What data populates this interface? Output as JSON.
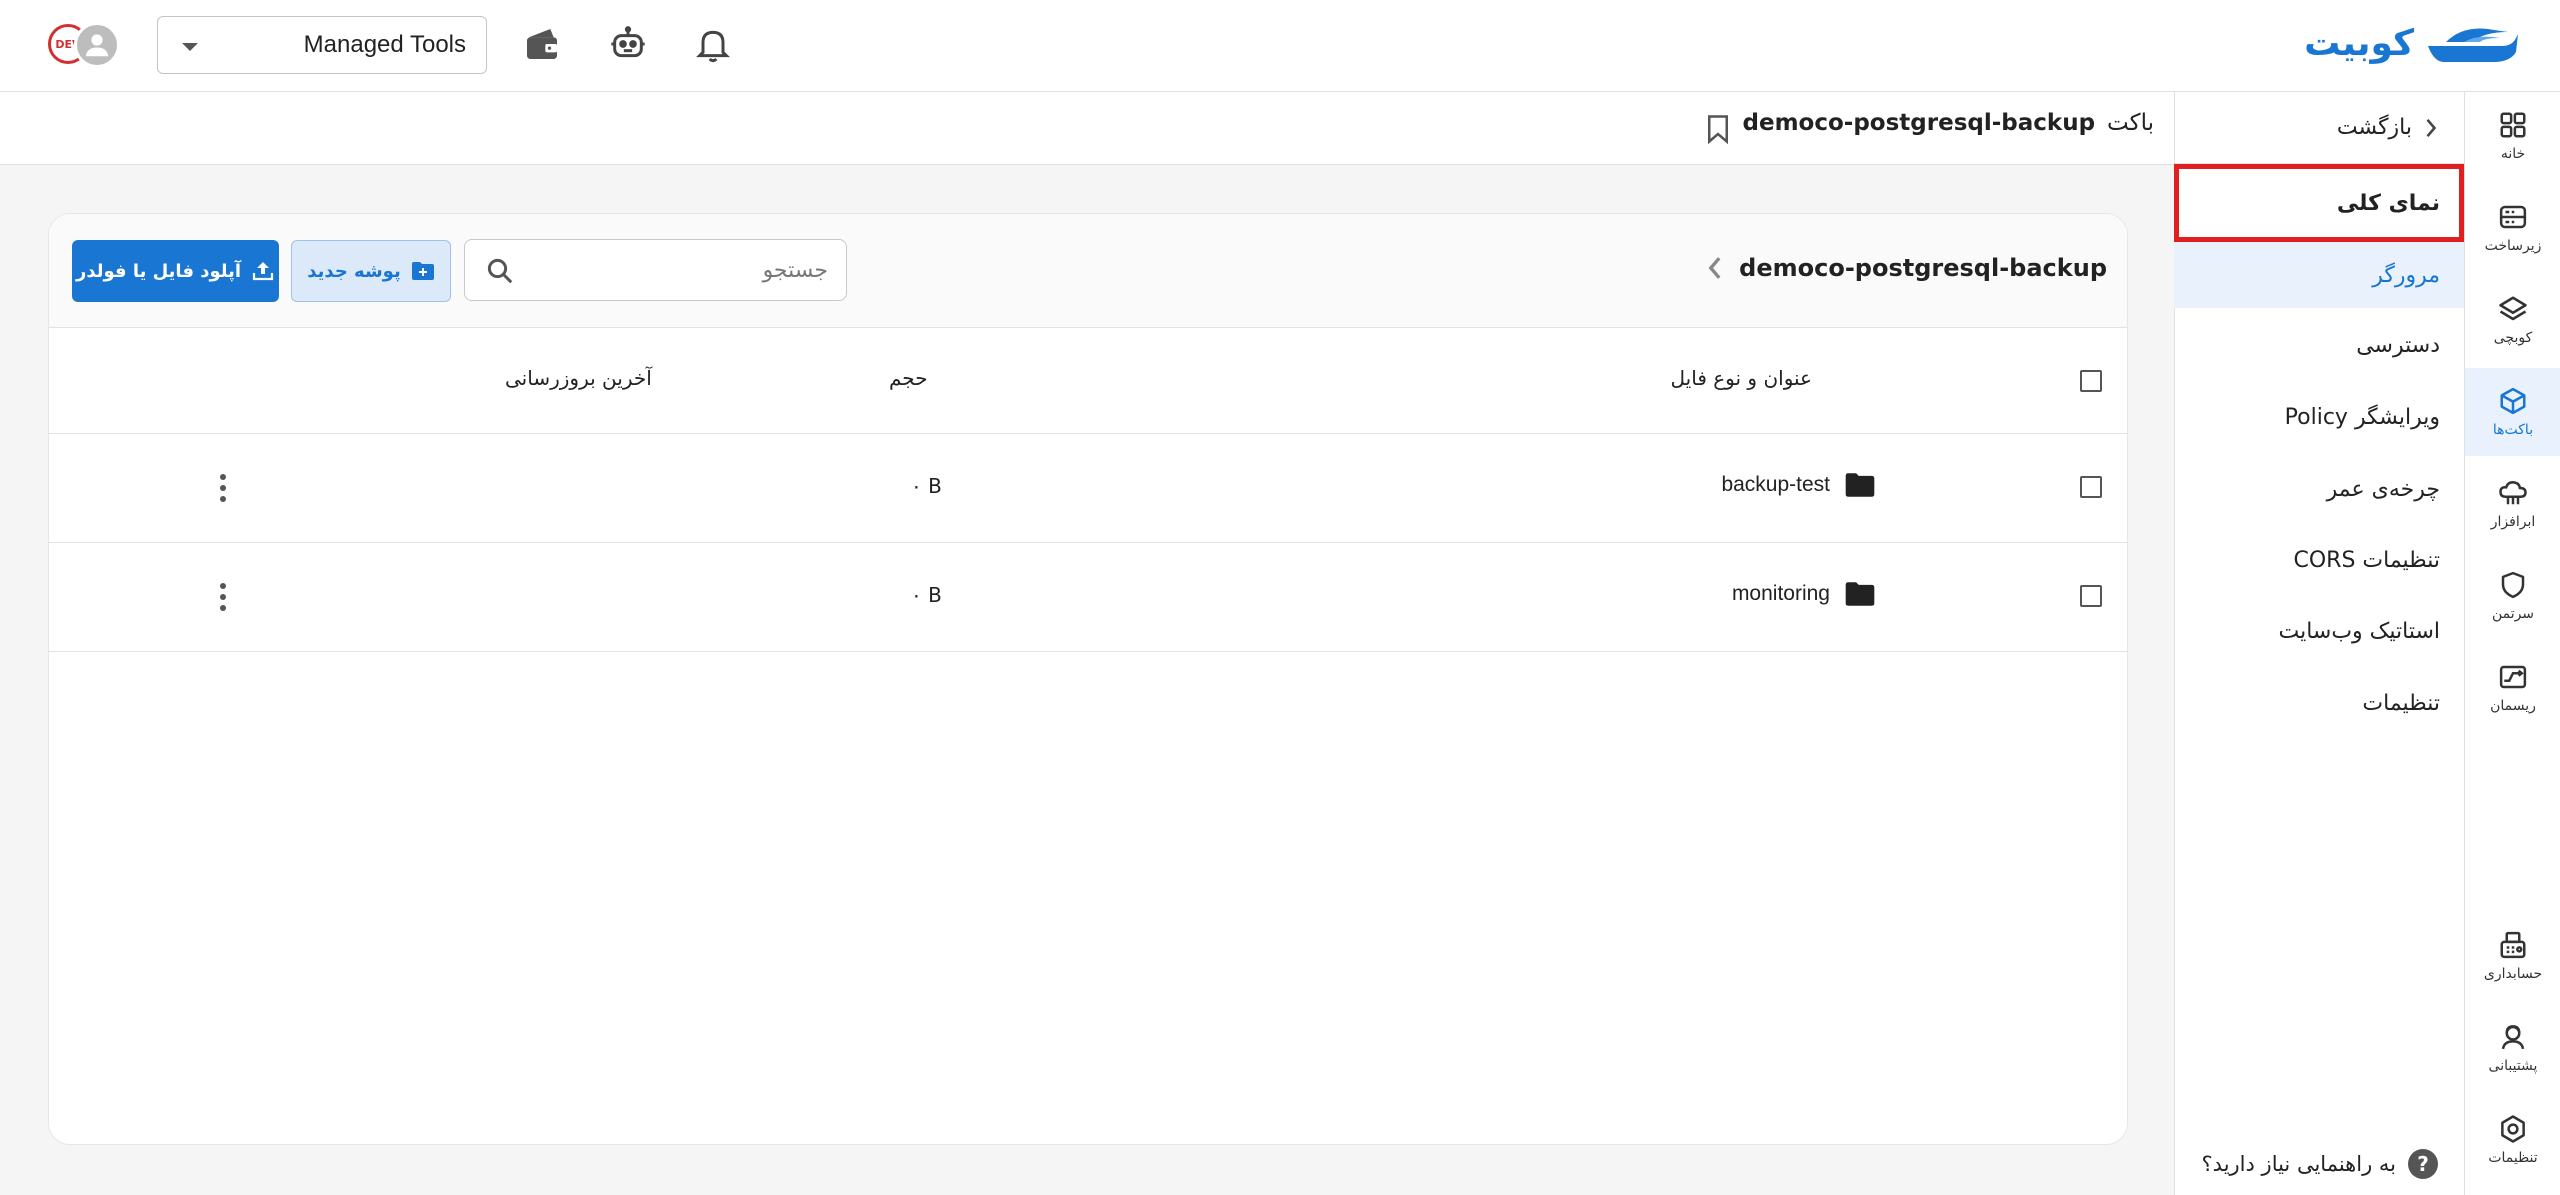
{
  "header": {
    "logo_text": "کوبیت",
    "org_select_value": "Managed Tools",
    "avatar_badge": "DEV",
    "icons": [
      "bell-icon",
      "robot-icon",
      "wallet-icon"
    ]
  },
  "rail": {
    "items": [
      {
        "label": "خانه",
        "icon": "home-grid-icon"
      },
      {
        "label": "زیرساخت",
        "icon": "server-icon"
      },
      {
        "label": "کوبچی",
        "icon": "layers-icon"
      },
      {
        "label": "باکت‌ها",
        "icon": "cube-icon"
      },
      {
        "label": "ابرافزار",
        "icon": "cloud-app-icon"
      },
      {
        "label": "سرتمن",
        "icon": "shield-icon"
      },
      {
        "label": "ریسمان",
        "icon": "rope-icon"
      },
      {
        "label": "حسابداری",
        "icon": "accounting-icon"
      },
      {
        "label": "پشتیبانی",
        "icon": "support-icon"
      },
      {
        "label": "تنظیمات",
        "icon": "settings-icon"
      }
    ],
    "active_index": 3
  },
  "submenu": {
    "back_label": "بازگشت",
    "items": [
      {
        "label": "نمای کلی"
      },
      {
        "label": "مرورگر"
      },
      {
        "label": "دسترسی"
      },
      {
        "label": "ویرایشگر Policy"
      },
      {
        "label": "چرخه‌ی عمر"
      },
      {
        "label": "تنظیمات CORS"
      },
      {
        "label": "استاتیک وب‌سایت"
      },
      {
        "label": "تنظیمات"
      }
    ],
    "active_index": 1,
    "highlighted_index": 0,
    "help_text": "به راهنمایی نیاز دارید؟",
    "help_icon_text": "?"
  },
  "page": {
    "title_prefix": "باکت",
    "bucket_name": "democo-postgresql-backup"
  },
  "browser": {
    "breadcrumb": "democo-postgresql-backup",
    "search_placeholder": "جستجو",
    "new_folder_label": "پوشه جدید",
    "upload_label": "آپلود فایل یا فولدر",
    "columns": {
      "name": "عنوان و نوع فایل",
      "size": "حجم",
      "updated": "آخرین بروزرسانی"
    },
    "rows": [
      {
        "name": "backup-test",
        "type": "folder",
        "size": "۰ B",
        "updated": ""
      },
      {
        "name": "monitoring",
        "type": "folder",
        "size": "۰ B",
        "updated": ""
      }
    ]
  },
  "colors": {
    "accent": "#1976d2",
    "highlight_box": "#e02020",
    "active_bg": "#e8f1fc"
  }
}
